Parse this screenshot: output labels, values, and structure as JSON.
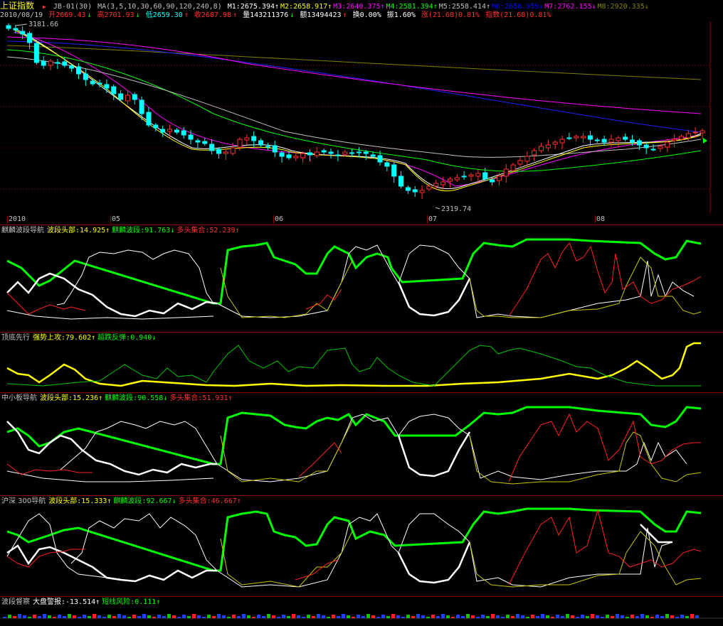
{
  "header": {
    "index_name": "上证指数",
    "indicator": "JB-01(30)",
    "ma_label": "MA(3,5,10,30,60,90,120,240,8)",
    "ma_values": [
      {
        "label": "M1:2675.394",
        "arrow": "↑",
        "color": "#ffffff"
      },
      {
        "label": "M2:2658.917",
        "arrow": "↑",
        "color": "#ffff00"
      },
      {
        "label": "M3:2640.375",
        "arrow": "↑",
        "color": "#ff00ff"
      },
      {
        "label": "M4:2581.394",
        "arrow": "↑",
        "color": "#00ff00"
      },
      {
        "label": "M5:2558.414",
        "arrow": "↑",
        "color": "#c0c0c0"
      },
      {
        "label": "M6:2658.959",
        "arrow": "↓",
        "color": "#0000ff"
      },
      {
        "label": "M7:2762.155",
        "arrow": "↓",
        "color": "#ff00ff"
      },
      {
        "label": "M8:2920.335",
        "arrow": "↓",
        "color": "#808000"
      }
    ],
    "date": "2010/08/19",
    "open": {
      "label": "开2669.43",
      "arrow": "↓"
    },
    "high": {
      "label": "高2701.93",
      "arrow": "↓"
    },
    "low": {
      "label": "低2659.30",
      "arrow": "↑"
    },
    "close": {
      "label": "收2687.98",
      "arrow": "↑"
    },
    "volume": {
      "label": "量143211376",
      "arrow": "↓"
    },
    "amount": {
      "label": "额13494423",
      "arrow": "↑"
    },
    "turnover": "换0.00%",
    "amplitude": "振1.60%",
    "change": "涨(21.68)0.81%",
    "index_change": "指数(21.68)0.81%",
    "high_label": "3181.66",
    "low_label": "2319.74"
  },
  "date_axis": [
    "2010",
    "05",
    "06",
    "07",
    "08"
  ],
  "panels": [
    {
      "name": "麒麟波段导航",
      "items": [
        {
          "label": "波段头部:14.925",
          "arrow": "↑",
          "color": "#ffff00"
        },
        {
          "label": "麒麟波段:91.763",
          "arrow": "↓",
          "color": "#00ff00"
        },
        {
          "label": "多头集合:52.239",
          "arrow": "↑",
          "color": "#ff3030"
        }
      ]
    },
    {
      "name": "顶底先行",
      "items": [
        {
          "label": "强势上攻:79.602",
          "arrow": "↑",
          "color": "#ffff00"
        },
        {
          "label": "超跌反弹:0.940",
          "arrow": "↓",
          "color": "#00ff00"
        }
      ]
    },
    {
      "name": "中小板导航",
      "items": [
        {
          "label": "波段头部:15.236",
          "arrow": "↑",
          "color": "#ffff00"
        },
        {
          "label": "麒麟波段:90.558",
          "arrow": "↓",
          "color": "#00ff00"
        },
        {
          "label": "多头集合:51.931",
          "arrow": "↑",
          "color": "#ff3030"
        }
      ]
    },
    {
      "name": "沪深 300导航",
      "items": [
        {
          "label": "波段头部:15.333",
          "arrow": "↑",
          "color": "#ffff00"
        },
        {
          "label": "麒麟波段:92.667",
          "arrow": "↓",
          "color": "#00ff00"
        },
        {
          "label": "多头集合:46.667",
          "arrow": "↑",
          "color": "#ff3030"
        }
      ]
    },
    {
      "name": "波段督察",
      "items": [
        {
          "label": "大盘警报:-13.514",
          "arrow": "↑",
          "color": "#ffffff"
        },
        {
          "label": "短线风险:0.111",
          "arrow": "↑",
          "color": "#00ff00"
        }
      ]
    }
  ],
  "colors": {
    "up": "#ff3030",
    "down": "#00ffff",
    "grid": "#8b0000"
  }
}
